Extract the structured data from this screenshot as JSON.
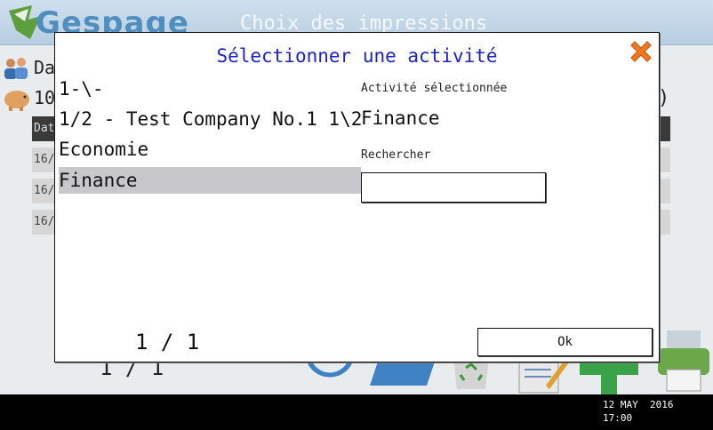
{
  "background": {
    "logo_text": "Gespage",
    "header_title": "Choix des impressions",
    "row_label_1": "Da",
    "row_label_2": "10",
    "paren": ")",
    "table_head_label": "Dat",
    "table_rows": [
      "16/",
      "16/",
      "16/"
    ],
    "pager": "1 / 1"
  },
  "modal": {
    "title": "Sélectionner une activité",
    "items": [
      "1-\\-",
      "1/2 - Test Company No.1 1\\2",
      "Economie",
      "Finance"
    ],
    "selected_index": 3,
    "selected_label": "Activité sélectionnée",
    "selected_value": "Finance",
    "search_label": "Rechercher",
    "search_value": "",
    "pager": "1 / 1",
    "ok_label": "Ok"
  },
  "status": {
    "date": "12 MAY  2016",
    "time": "17:00"
  },
  "colors": {
    "title": "#1d23c9",
    "close": "#f07820",
    "selection": "#c8c8cc"
  },
  "icons": {
    "close": "close-x-icon",
    "users": "users-icon",
    "piggy": "piggy-bank-icon"
  }
}
